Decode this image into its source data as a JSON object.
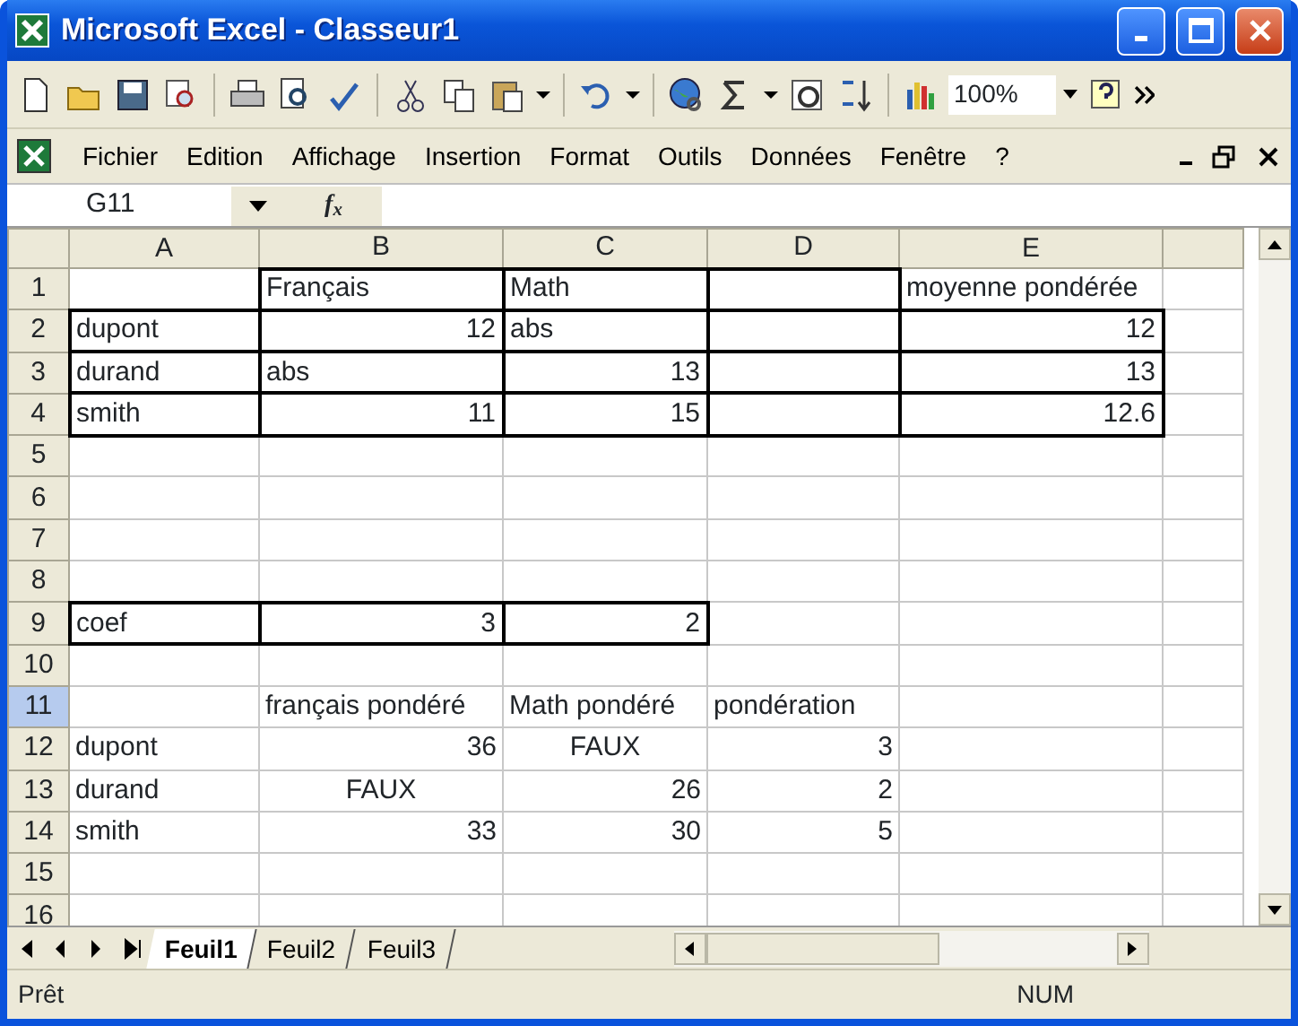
{
  "window": {
    "title": "Microsoft Excel - Classeur1"
  },
  "toolbar": {
    "zoom": "100%"
  },
  "menu": [
    {
      "label": "Fichier"
    },
    {
      "label": "Edition"
    },
    {
      "label": "Affichage"
    },
    {
      "label": "Insertion"
    },
    {
      "label": "Format"
    },
    {
      "label": "Outils"
    },
    {
      "label": "Données"
    },
    {
      "label": "Fenêtre"
    },
    {
      "label": "?"
    }
  ],
  "name_box": "G11",
  "function_symbol": "f$_{x}$",
  "columns": [
    {
      "label": "A"
    },
    {
      "label": "B"
    },
    {
      "label": "C"
    },
    {
      "label": "D"
    },
    {
      "label": "E"
    }
  ],
  "rows": [
    {
      "label": "1",
      "selected": false,
      "cells": [
        {},
        {
          "value": "Français",
          "kind": "text",
          "boxed": true
        },
        {
          "value": "Math",
          "kind": "text",
          "boxed": true
        },
        {
          "boxed": true
        },
        {
          "value": "moyenne pondérée",
          "kind": "text"
        }
      ]
    },
    {
      "label": "2",
      "selected": false,
      "cells": [
        {
          "value": "dupont",
          "kind": "text",
          "boxed": true
        },
        {
          "value": "12",
          "kind": "number",
          "boxed": true
        },
        {
          "value": "abs",
          "kind": "text",
          "boxed": true
        },
        {
          "boxed": true
        },
        {
          "value": "12",
          "kind": "number",
          "boxed": true
        }
      ]
    },
    {
      "label": "3",
      "selected": false,
      "cells": [
        {
          "value": "durand",
          "kind": "text",
          "boxed": true
        },
        {
          "value": "abs",
          "kind": "text",
          "boxed": true
        },
        {
          "value": "13",
          "kind": "number",
          "boxed": true
        },
        {
          "boxed": true
        },
        {
          "value": "13",
          "kind": "number",
          "boxed": true
        }
      ]
    },
    {
      "label": "4",
      "selected": false,
      "cells": [
        {
          "value": "smith",
          "kind": "text",
          "boxed": true
        },
        {
          "value": "11",
          "kind": "number",
          "boxed": true
        },
        {
          "value": "15",
          "kind": "number",
          "boxed": true
        },
        {
          "boxed": true
        },
        {
          "value": "12.6",
          "kind": "number",
          "boxed": true
        }
      ]
    },
    {
      "label": "5",
      "selected": false,
      "cells": [
        {},
        {},
        {},
        {},
        {}
      ]
    },
    {
      "label": "6",
      "selected": false,
      "cells": [
        {},
        {},
        {},
        {},
        {}
      ]
    },
    {
      "label": "7",
      "selected": false,
      "cells": [
        {},
        {},
        {},
        {},
        {}
      ]
    },
    {
      "label": "8",
      "selected": false,
      "cells": [
        {},
        {},
        {},
        {},
        {}
      ]
    },
    {
      "label": "9",
      "selected": false,
      "cells": [
        {
          "value": "coef",
          "kind": "text",
          "boxed": true
        },
        {
          "value": "3",
          "kind": "number",
          "boxed": true
        },
        {
          "value": "2",
          "kind": "number",
          "boxed": true
        },
        {},
        {}
      ]
    },
    {
      "label": "10",
      "selected": false,
      "cells": [
        {},
        {},
        {},
        {},
        {}
      ]
    },
    {
      "label": "11",
      "selected": true,
      "cells": [
        {},
        {
          "value": "français pondéré",
          "kind": "text"
        },
        {
          "value": "Math pondéré",
          "kind": "text"
        },
        {
          "value": "pondération",
          "kind": "text"
        },
        {}
      ]
    },
    {
      "label": "12",
      "selected": false,
      "cells": [
        {
          "value": "dupont",
          "kind": "text"
        },
        {
          "value": "36",
          "kind": "number"
        },
        {
          "value": "FAUX",
          "kind": "bool"
        },
        {
          "value": "3",
          "kind": "number"
        },
        {}
      ]
    },
    {
      "label": "13",
      "selected": false,
      "cells": [
        {
          "value": "durand",
          "kind": "text"
        },
        {
          "value": "FAUX",
          "kind": "bool"
        },
        {
          "value": "26",
          "kind": "number"
        },
        {
          "value": "2",
          "kind": "number"
        },
        {}
      ]
    },
    {
      "label": "14",
      "selected": false,
      "cells": [
        {
          "value": "smith",
          "kind": "text"
        },
        {
          "value": "33",
          "kind": "number"
        },
        {
          "value": "30",
          "kind": "number"
        },
        {
          "value": "5",
          "kind": "number"
        },
        {}
      ]
    },
    {
      "label": "15",
      "selected": false,
      "cells": [
        {},
        {},
        {},
        {},
        {}
      ]
    },
    {
      "label": "16",
      "selected": false,
      "cells": [
        {},
        {},
        {},
        {},
        {}
      ]
    }
  ],
  "sheets": [
    {
      "label": "Feuil1",
      "selected": true
    },
    {
      "label": "Feuil2",
      "selected": false
    },
    {
      "label": "Feuil3",
      "selected": false
    }
  ],
  "status_bar": {
    "text": "Prêt",
    "num": "NUM"
  }
}
